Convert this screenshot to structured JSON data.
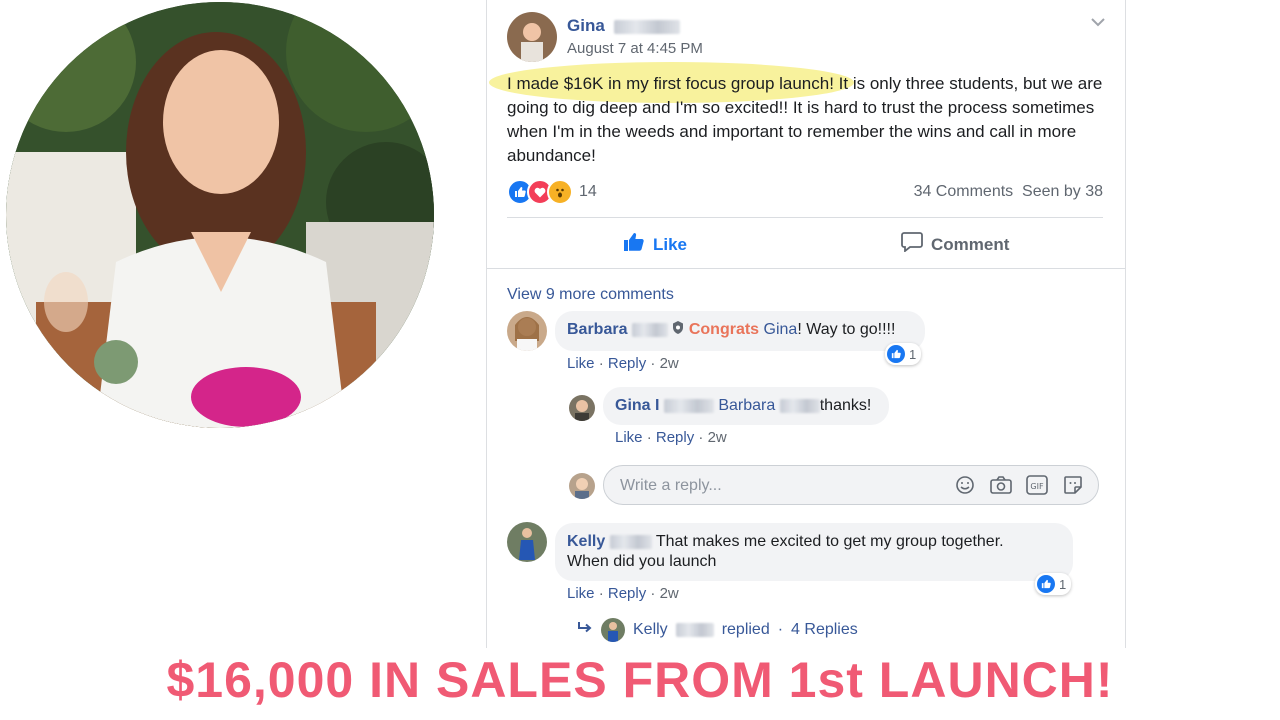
{
  "post": {
    "author": "Gina",
    "timestamp": "August 7 at 4:45 PM",
    "highlighted_text": "I made $16K in my first focus group launch! It",
    "body_text": " is only three students, but we are going to dig deep and I'm so excited!! It is hard to trust the process sometimes when I'm in the weeds and important to remember the wins and call in more abundance!",
    "reaction_count": "14",
    "comments_count": "34 Comments",
    "seen_by": "Seen by 38",
    "like_label": "Like",
    "comment_label": "Comment"
  },
  "comments": {
    "view_more": "View 9 more comments",
    "barbara": {
      "author": "Barbara",
      "congrats": "Congrats",
      "mention": "Gina",
      "text": "! Way to go!!!!",
      "like": "Like",
      "reply": "Reply",
      "time": "2w",
      "likes": "1"
    },
    "gina_reply": {
      "author": "Gina I",
      "mention": "Barbara",
      "text": "thanks!",
      "like": "Like",
      "reply": "Reply",
      "time": "2w"
    },
    "reply_box": {
      "placeholder": "Write a reply..."
    },
    "kelly": {
      "author": "Kelly",
      "text": "That makes me excited to get my group together.",
      "text2": "When did you launch",
      "like": "Like",
      "reply": "Reply",
      "time": "2w",
      "likes": "1"
    },
    "kelly_replies": {
      "author": "Kelly",
      "replied": "replied",
      "count": "4 Replies"
    }
  },
  "banner": {
    "text": "$16,000 IN SALES FROM 1st LAUNCH!"
  },
  "icons": [
    "like-icon",
    "love-icon",
    "wow-icon",
    "thumbs-up-icon",
    "comment-icon",
    "chevron-down-icon",
    "emoji-icon",
    "camera-icon",
    "gif-icon",
    "sticker-icon",
    "reply-arrow-icon"
  ],
  "colors": {
    "link": "#385898",
    "like_blue": "#1877f2",
    "highlight": "#f7f08c",
    "banner": "#f05a74"
  }
}
